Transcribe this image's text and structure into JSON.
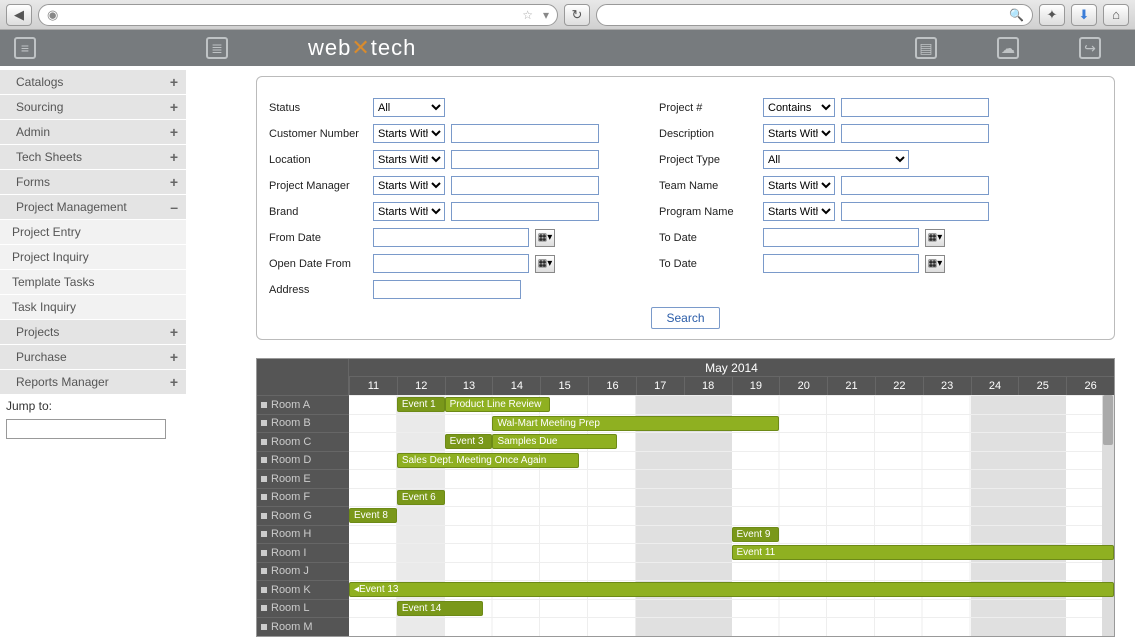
{
  "browser": {
    "back_icon": "◀",
    "globe_icon": "◉",
    "star_icon": "☆",
    "dropdown_icon": "▾",
    "reload_icon": "↻",
    "search_icon": "🔍",
    "bookmark_icon": "✦",
    "download_icon": "⬇",
    "home_icon": "⌂"
  },
  "header": {
    "logo_a": "web",
    "logo_x": "✕",
    "logo_b": "tech"
  },
  "sidebar": {
    "items": [
      {
        "label": "Catalogs",
        "toggle": "+",
        "indent": true
      },
      {
        "label": "Sourcing",
        "toggle": "+",
        "indent": true
      },
      {
        "label": "Admin",
        "toggle": "+",
        "indent": true
      },
      {
        "label": "Tech Sheets",
        "toggle": "+",
        "indent": true
      },
      {
        "label": "Forms",
        "toggle": "+",
        "indent": true
      },
      {
        "label": "Project Management",
        "toggle": "–",
        "indent": true
      },
      {
        "label": "Project Entry",
        "sub": true
      },
      {
        "label": "Project Inquiry",
        "sub": true
      },
      {
        "label": "Template Tasks",
        "sub": true
      },
      {
        "label": "Task Inquiry",
        "sub": true
      },
      {
        "label": "Projects",
        "toggle": "+",
        "indent": true
      },
      {
        "label": "Purchase",
        "toggle": "+",
        "indent": true
      },
      {
        "label": "Reports Manager",
        "toggle": "+",
        "indent": true
      }
    ],
    "jump_label": "Jump to:"
  },
  "filters": {
    "left": [
      {
        "label": "Status",
        "type": "select-only",
        "value": "All"
      },
      {
        "label": "Customer Number",
        "type": "combo",
        "value": "Starts With"
      },
      {
        "label": "Location",
        "type": "combo",
        "value": "Starts With"
      },
      {
        "label": "Project Manager",
        "type": "combo",
        "value": "Starts With"
      },
      {
        "label": "Brand",
        "type": "combo",
        "value": "Starts With"
      },
      {
        "label": "From Date",
        "type": "date"
      },
      {
        "label": "Open Date From",
        "type": "date"
      },
      {
        "label": "Address",
        "type": "text"
      }
    ],
    "right": [
      {
        "label": "Project #",
        "type": "combo",
        "value": "Contains"
      },
      {
        "label": "Description",
        "type": "combo",
        "value": "Starts With"
      },
      {
        "label": "Project Type",
        "type": "select-wide",
        "value": "All"
      },
      {
        "label": "Team Name",
        "type": "combo",
        "value": "Starts With"
      },
      {
        "label": "Program Name",
        "type": "combo",
        "value": "Starts With"
      },
      {
        "label": "To Date",
        "type": "date"
      },
      {
        "label": "To Date",
        "type": "date"
      }
    ],
    "search_label": "Search"
  },
  "gantt": {
    "month": "May 2014",
    "days": [
      "11",
      "12",
      "13",
      "14",
      "15",
      "16",
      "17",
      "18",
      "19",
      "20",
      "21",
      "22",
      "23",
      "24",
      "25",
      "26"
    ],
    "rooms": [
      "Room A",
      "Room B",
      "Room C",
      "Room D",
      "Room E",
      "Room F",
      "Room G",
      "Room H",
      "Room I",
      "Room J",
      "Room K",
      "Room L",
      "Room M"
    ],
    "day_width_pct": 6.25,
    "events": [
      {
        "room": 0,
        "label": "Event 1",
        "start": 1,
        "span": 1,
        "dark": true
      },
      {
        "room": 0,
        "label": "Product Line Review",
        "start": 2,
        "span": 2.2
      },
      {
        "room": 1,
        "label": "Wal-Mart Meeting Prep",
        "start": 3,
        "span": 6
      },
      {
        "room": 2,
        "label": "Event 3",
        "start": 2,
        "span": 1,
        "dark": true
      },
      {
        "room": 2,
        "label": "Samples Due",
        "start": 3,
        "span": 2.6
      },
      {
        "room": 3,
        "label": "Sales Dept. Meeting Once Again",
        "start": 1,
        "span": 3.8
      },
      {
        "room": 5,
        "label": "Event 6",
        "start": 1,
        "span": 1,
        "dark": true
      },
      {
        "room": 6,
        "label": "Event 8",
        "start": 0,
        "span": 1,
        "dark": true
      },
      {
        "room": 7,
        "label": "Event 9",
        "start": 8,
        "span": 1,
        "dark": true
      },
      {
        "room": 8,
        "label": "Event 11",
        "start": 8,
        "span": 8
      },
      {
        "room": 10,
        "label": "◂Event 13",
        "start": 0,
        "span": 16
      },
      {
        "room": 11,
        "label": "Event 14",
        "start": 1,
        "span": 1.8,
        "dark": true
      }
    ]
  }
}
